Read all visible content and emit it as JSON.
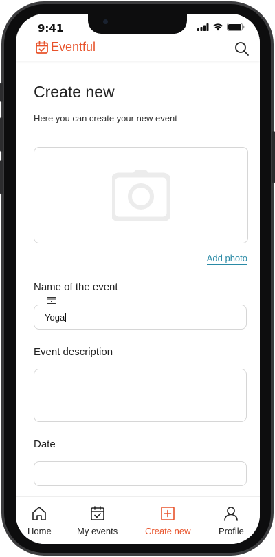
{
  "status_bar": {
    "time": "9:41"
  },
  "app": {
    "name": "Eventful"
  },
  "page": {
    "title": "Create new",
    "subtitle": "Here you can create your new event"
  },
  "photo": {
    "add_label": "Add photo"
  },
  "form": {
    "name_label": "Name of the event",
    "name_value": "Yoga",
    "description_label": "Event description",
    "description_value": "",
    "date_label": "Date",
    "date_value": ""
  },
  "tabs": [
    {
      "label": "Home",
      "icon": "home-icon",
      "active": false
    },
    {
      "label": "My events",
      "icon": "calendar-check-icon",
      "active": false
    },
    {
      "label": "Create new",
      "icon": "plus-square-icon",
      "active": true
    },
    {
      "label": "Profile",
      "icon": "user-icon",
      "active": false
    }
  ],
  "colors": {
    "accent": "#e8532b",
    "link": "#2a8aa6",
    "border": "#d6d6d6"
  }
}
